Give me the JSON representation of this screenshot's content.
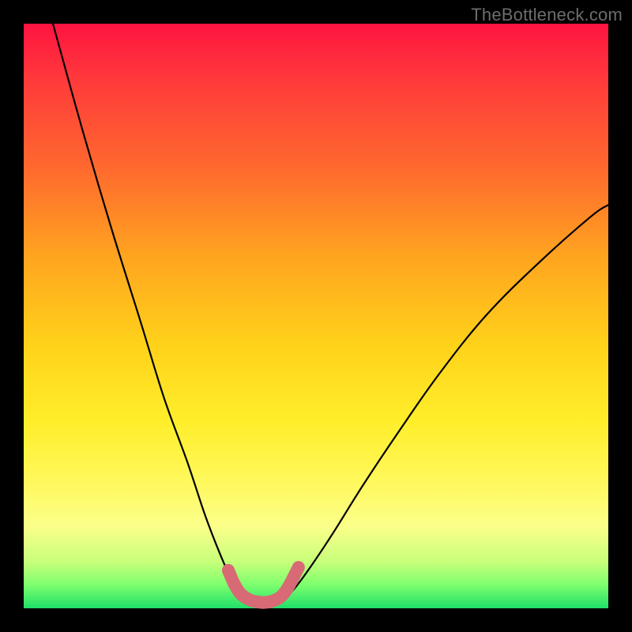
{
  "watermark": {
    "text": "TheBottleneck.com"
  },
  "chart_data": {
    "type": "line",
    "title": "",
    "xlabel": "",
    "ylabel": "",
    "xlim": [
      0,
      100
    ],
    "ylim": [
      0,
      100
    ],
    "series": [
      {
        "name": "left-curve",
        "x": [
          5,
          10,
          15,
          20,
          24,
          28,
          31,
          33.5,
          35.5,
          37,
          38.5
        ],
        "y": [
          100,
          82,
          65,
          49,
          36,
          25,
          16,
          9.5,
          5,
          2.5,
          1.5
        ]
      },
      {
        "name": "right-curve",
        "x": [
          44,
          46,
          49,
          53,
          58,
          64,
          71,
          79,
          88,
          97,
          100
        ],
        "y": [
          1.5,
          3,
          7,
          13,
          21,
          30,
          40,
          50,
          59,
          67,
          69
        ]
      },
      {
        "name": "bottom-marker",
        "x": [
          35,
          36,
          37,
          38,
          39,
          40,
          41,
          42,
          43,
          44,
          45,
          46,
          47
        ],
        "y": [
          6.5,
          4.2,
          2.6,
          1.8,
          1.3,
          1.1,
          1.0,
          1.1,
          1.4,
          2.0,
          3.2,
          5.0,
          7.0
        ]
      }
    ],
    "marker_color": "#d86a75",
    "curve_color": "#000000"
  }
}
